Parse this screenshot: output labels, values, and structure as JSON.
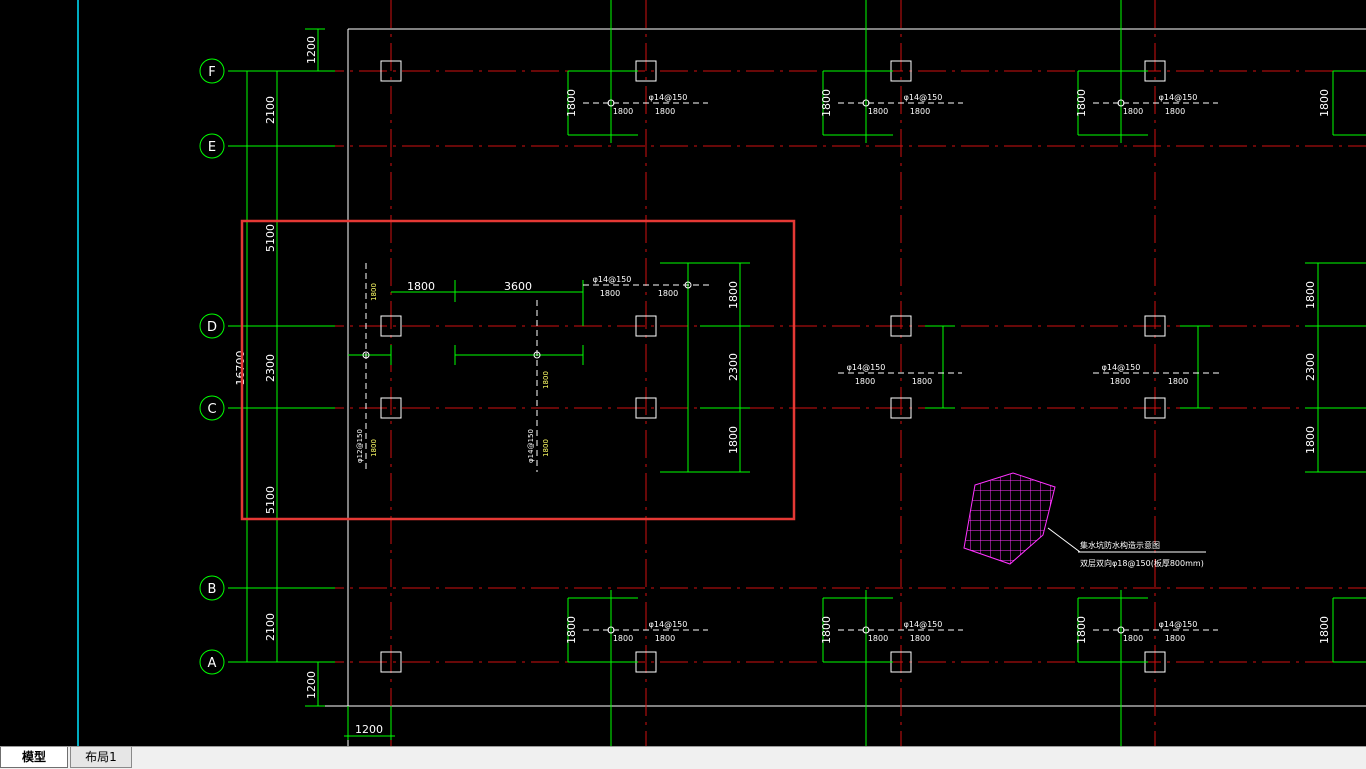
{
  "grid_labels": [
    "F",
    "E",
    "D",
    "C",
    "B",
    "A"
  ],
  "dims": {
    "d1200": "1200",
    "d2100": "2100",
    "d5100": "5100",
    "d2300": "2300",
    "d1800": "1800",
    "d3600": "3600",
    "d16700": "16700"
  },
  "rebar": {
    "r14": "φ14@150",
    "r12": "φ12@150"
  },
  "legend": {
    "line1": "集水坑防水构造示意图",
    "line2": "双层双向φ18@150(板厚800mm)"
  },
  "tabs": {
    "model": "模型",
    "layout1": "布局1"
  },
  "colors": {
    "background": "#000000",
    "dimension": "#00ff00",
    "axis": "#ff0000",
    "outline": "#ffffff",
    "highlight_box": "#e53935",
    "hatch": "#ff33ff",
    "viewport_edge": "#00ffff",
    "small_text": "#ffff66"
  }
}
